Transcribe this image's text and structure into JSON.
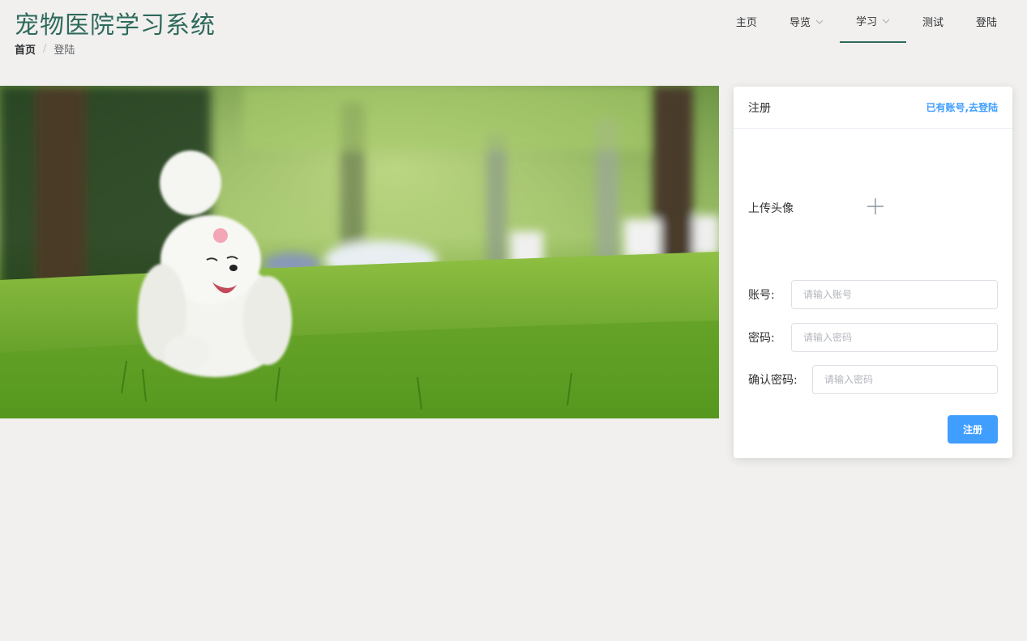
{
  "header": {
    "title": "宠物医院学习系统",
    "breadcrumb": {
      "home": "首页",
      "separator": "/",
      "current": "登陆"
    }
  },
  "nav": {
    "items": [
      {
        "label": "主页"
      },
      {
        "label": "导览",
        "icon": "chevron-down-icon"
      },
      {
        "label": "学习",
        "icon": "chevron-down-icon"
      },
      {
        "label": "测试"
      },
      {
        "label": "登陆"
      }
    ]
  },
  "form": {
    "title": "注册",
    "login_link": "已有账号,去登陆",
    "avatar_label": "上传头像",
    "avatar_icon": "plus-icon",
    "account_label": "账号:",
    "account_placeholder": "请输入账号",
    "password_label": "密码:",
    "password_placeholder": "请输入密码",
    "confirm_label": "确认密码:",
    "confirm_placeholder": "请输入密码",
    "submit_label": "注册"
  },
  "colors": {
    "brand": "#2f6a5c",
    "accent": "#409eff",
    "background": "#f1f0ef"
  }
}
